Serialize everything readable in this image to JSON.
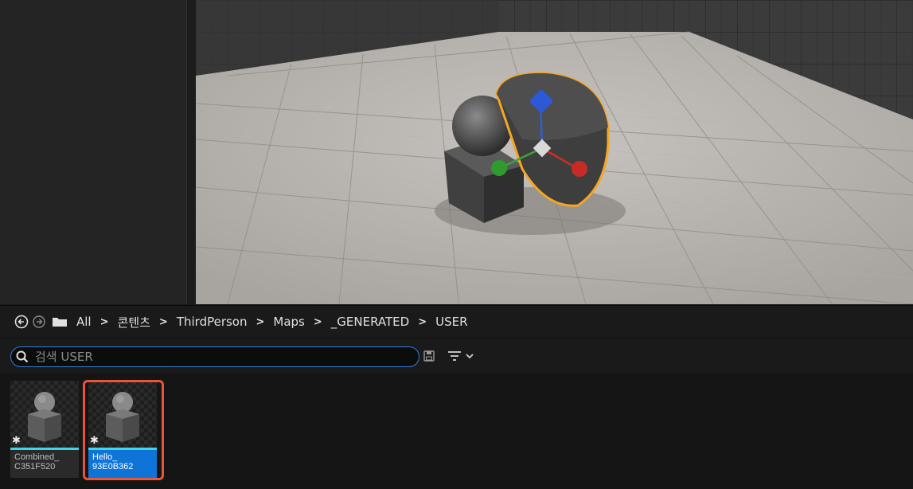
{
  "breadcrumb": {
    "items": [
      "All",
      "콘텐츠",
      "ThirdPerson",
      "Maps",
      "_GENERATED",
      "USER"
    ]
  },
  "search": {
    "placeholder": "검색 USER"
  },
  "assets": [
    {
      "line1": "Combined_",
      "line2": "C351F520",
      "selected": false
    },
    {
      "line1": "Hello_",
      "line2": "93E0B362",
      "selected": true
    }
  ],
  "icons": {
    "back": "back-arrow-icon",
    "forward": "forward-arrow-icon",
    "folder": "folder-icon",
    "search": "search-icon",
    "save": "save-icon",
    "filter": "filter-icon",
    "dropdown": "chevron-down-icon"
  },
  "colors": {
    "selection": "#0e74d8",
    "highlight": "#e8553a",
    "asset_type_bar": "#3fd6e8",
    "search_border": "#2f7fd8",
    "outline_selected_actor": "#f5a623"
  }
}
